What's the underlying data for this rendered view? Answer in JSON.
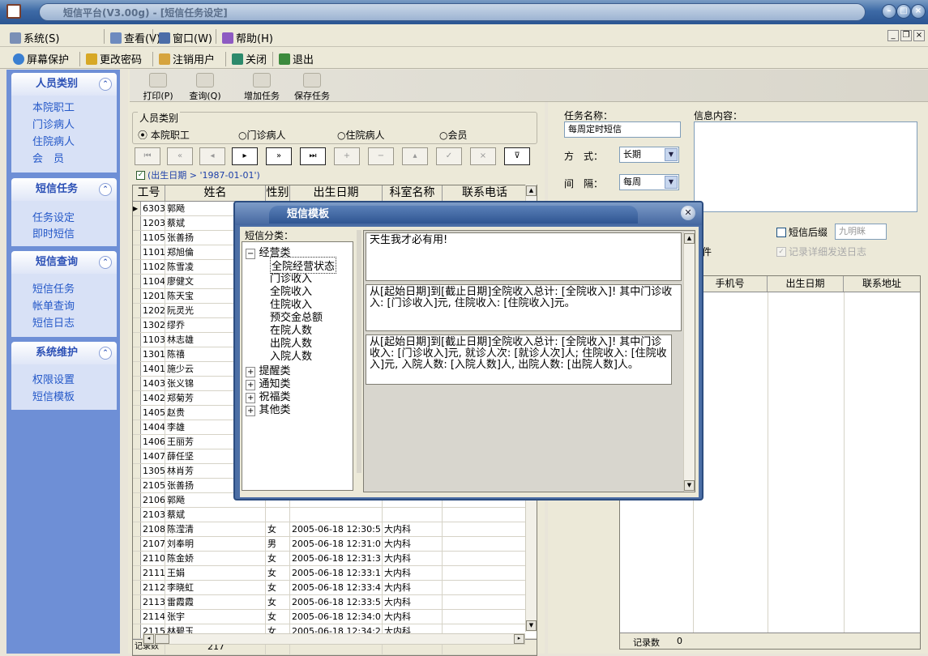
{
  "window": {
    "title": "短信平台(V3.00g) - [短信任务设定]"
  },
  "menu": {
    "items": [
      "系统(S)",
      "查看(V)",
      "窗口(W)",
      "帮助(H)"
    ]
  },
  "toolbar": {
    "items": [
      "屏幕保护",
      "更改密码",
      "注销用户",
      "关闭",
      "退出"
    ]
  },
  "sidebar": {
    "sections": [
      {
        "title": "人员类别",
        "links": [
          "本院职工",
          "门诊病人",
          "住院病人",
          "会　员"
        ]
      },
      {
        "title": "短信任务",
        "links": [
          "任务设定",
          "即时短信"
        ]
      },
      {
        "title": "短信查询",
        "links": [
          "短信任务",
          "帐单查询",
          "短信日志"
        ]
      },
      {
        "title": "系统维护",
        "links": [
          "权限设置",
          "短信模板"
        ]
      }
    ]
  },
  "actions": {
    "print": "打印(P)",
    "query": "查询(Q)",
    "add": "增加任务",
    "save": "保存任务"
  },
  "person_group": {
    "label": "人员类别",
    "options": [
      "本院职工",
      "门诊病人",
      "住院病人",
      "会员"
    ],
    "selected": "本院职工"
  },
  "filter": {
    "text": "(出生日期 > '1987-01-01')"
  },
  "grid": {
    "headers": [
      "工号",
      "姓名",
      "性别",
      "出生日期",
      "科室名称",
      "联系电话"
    ],
    "rows": [
      [
        "6303",
        "郭飏",
        "",
        "",
        ""
      ],
      [
        "1203",
        "蔡斌",
        "",
        "",
        ""
      ],
      [
        "1105",
        "张善扬",
        "",
        "",
        ""
      ],
      [
        "1101",
        "郑旭倫",
        "",
        "",
        ""
      ],
      [
        "1102",
        "陈雪凌",
        "",
        "",
        ""
      ],
      [
        "1104",
        "廖健文",
        "",
        "",
        ""
      ],
      [
        "1201",
        "陈天宝",
        "",
        "",
        ""
      ],
      [
        "1202",
        "阮灵光",
        "",
        "",
        ""
      ],
      [
        "1302",
        "缪乔",
        "",
        "",
        ""
      ],
      [
        "1103",
        "林志雄",
        "",
        "",
        ""
      ],
      [
        "1301",
        "陈禧",
        "",
        "",
        ""
      ],
      [
        "1401",
        "施少云",
        "",
        "",
        ""
      ],
      [
        "1403",
        "张义锦",
        "",
        "",
        ""
      ],
      [
        "1402",
        "郑菊芳",
        "",
        "",
        ""
      ],
      [
        "1405",
        "赵贵",
        "",
        "",
        ""
      ],
      [
        "1404",
        "李雄",
        "",
        "",
        ""
      ],
      [
        "1406",
        "王丽芳",
        "",
        "",
        ""
      ],
      [
        "1407",
        "薛任坚",
        "",
        "",
        ""
      ],
      [
        "1305",
        "林肖芳",
        "",
        "",
        ""
      ],
      [
        "2105",
        "张善扬",
        "",
        "",
        ""
      ],
      [
        "2106",
        "郭飏",
        "",
        "",
        ""
      ],
      [
        "2103",
        "蔡斌",
        "",
        "",
        ""
      ],
      [
        "2108",
        "陈滢清",
        "女",
        "2005-06-18 12:30:5",
        "大内科"
      ],
      [
        "2107",
        "刘奉明",
        "男",
        "2005-06-18 12:31:0",
        "大内科"
      ],
      [
        "2110",
        "陈金娇",
        "女",
        "2005-06-18 12:31:3",
        "大内科"
      ],
      [
        "2111",
        "王娟",
        "女",
        "2005-06-18 12:33:1",
        "大内科"
      ],
      [
        "2112",
        "李晓虹",
        "女",
        "2005-06-18 12:33:4",
        "大内科"
      ],
      [
        "2113",
        "雷霞霞",
        "女",
        "2005-06-18 12:33:5",
        "大内科"
      ],
      [
        "2114",
        "张宇",
        "女",
        "2005-06-18 12:34:0",
        "大内科"
      ],
      [
        "2115",
        "林碧玉",
        "女",
        "2005-06-18 12:34:2",
        "大内科"
      ]
    ],
    "footer_label": "记录数",
    "footer_count": "217"
  },
  "task": {
    "name_label": "任务名称：",
    "name_value": "每周定时短信",
    "content_label": "信息内容：",
    "mode_label": "方　式：",
    "mode_value": "长期",
    "interval_label": "间　隔：",
    "interval_value": "每周",
    "suffix_label": "短信后缀",
    "suffix_value": "九明眯",
    "log_label": "记录详细发送日志",
    "partial_label": "件",
    "headers": [
      "手机号",
      "出生日期",
      "联系地址"
    ],
    "count_label": "记录数",
    "count_value": "0"
  },
  "dialog": {
    "title": "短信模板",
    "tree_label": "短信分类：",
    "tree": {
      "expanded": "经营类",
      "children": [
        "全院经营状态",
        "门诊收入",
        "全院收入",
        "住院收入",
        "预交金总额",
        "在院人数",
        "出院人数",
        "入院人数"
      ],
      "collapsed": [
        "提醒类",
        "通知类",
        "祝福类",
        "其他类"
      ]
    },
    "templates": [
      "天生我才必有用!",
      "从[起始日期]到[截止日期]全院收入总计: [全院收入]! 其中门诊收入: [门诊收入]元, 住院收入: [住院收入]元。",
      "从[起始日期]到[截止日期]全院收入总计: [全院收入]! 其中门诊收入: [门诊收入]元, 就诊人次: [就诊人次]人; 住院收入: [住院收入]元, 入院人数: [入院人数]人, 出院人数: [出院人数]人。"
    ]
  }
}
